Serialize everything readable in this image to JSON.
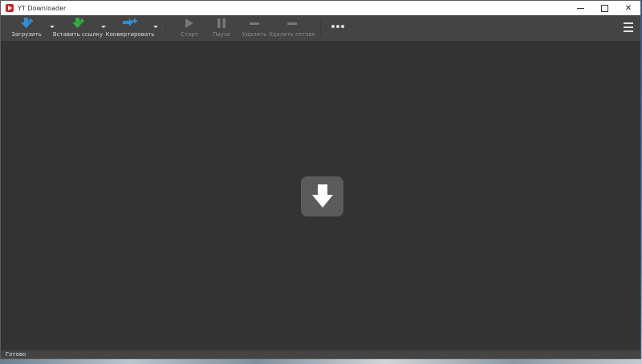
{
  "window": {
    "title": "YT Downloader"
  },
  "toolbar": {
    "download_label": "Загрузить",
    "paste_link_label": "Вставить ссылку",
    "convert_label": "Конвертировать",
    "start_label": "Старт",
    "pause_label": "Пауза",
    "delete_label": "Удалить",
    "delete_done_label": "Удалить готово"
  },
  "status": {
    "text": "Готово"
  },
  "colors": {
    "download_icon": "#2e8fd8",
    "paste_icon": "#2eae3a",
    "convert_icon": "#2e8fd8",
    "toolbar_bg": "#444444",
    "main_bg": "#333333"
  }
}
